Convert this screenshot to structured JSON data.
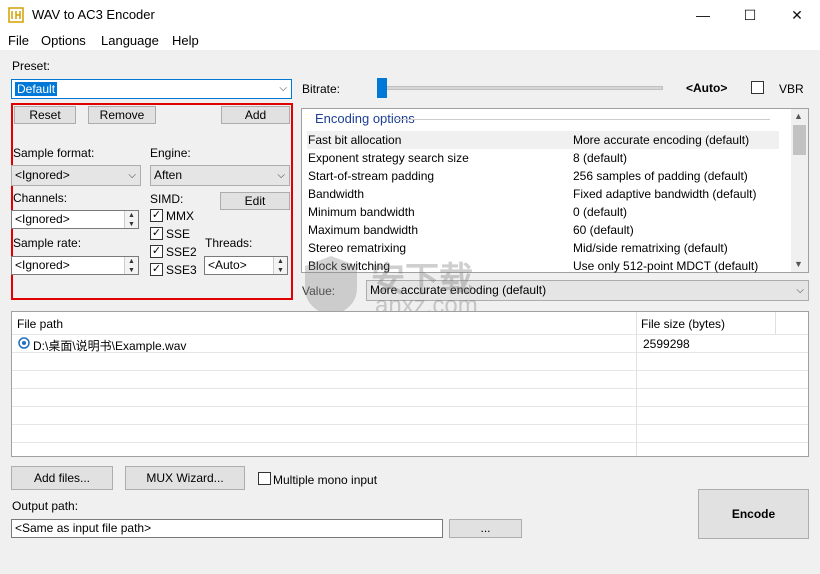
{
  "window": {
    "title": "WAV to AC3 Encoder",
    "minimize_glyph": "—",
    "maximize_glyph": "☐",
    "close_glyph": "✕"
  },
  "menu": [
    "File",
    "Options",
    "Language",
    "Help"
  ],
  "preset": {
    "label": "Preset:",
    "value": "Default",
    "reset": "Reset",
    "remove": "Remove",
    "add": "Add"
  },
  "settings": {
    "sample_format_label": "Sample format:",
    "sample_format_value": "<Ignored>",
    "engine_label": "Engine:",
    "engine_value": "Aften",
    "channels_label": "Channels:",
    "channels_value": "<Ignored>",
    "simd_label": "SIMD:",
    "edit": "Edit",
    "simd": [
      {
        "label": "MMX",
        "checked": true
      },
      {
        "label": "SSE",
        "checked": true
      },
      {
        "label": "SSE2",
        "checked": true
      },
      {
        "label": "SSE3",
        "checked": true
      }
    ],
    "sample_rate_label": "Sample rate:",
    "sample_rate_value": "<Ignored>",
    "threads_label": "Threads:",
    "threads_value": "<Auto>"
  },
  "bitrate": {
    "label": "Bitrate:",
    "value_text": "<Auto>",
    "vbr_label": "VBR",
    "slider_level": 0
  },
  "encoding_options": {
    "title": "Encoding options",
    "rows": [
      {
        "name": "Fast bit allocation",
        "value": "More accurate encoding (default)"
      },
      {
        "name": "Exponent strategy search size",
        "value": "8 (default)"
      },
      {
        "name": "Start-of-stream padding",
        "value": "256 samples of padding (default)"
      },
      {
        "name": "Bandwidth",
        "value": "Fixed adaptive bandwidth (default)"
      },
      {
        "name": "Minimum bandwidth",
        "value": "0 (default)"
      },
      {
        "name": "Maximum bandwidth",
        "value": "60 (default)"
      },
      {
        "name": "Stereo rematrixing",
        "value": "Mid/side rematrixing (default)"
      },
      {
        "name": "Block switching",
        "value": "Use only 512-point MDCT (default)"
      }
    ],
    "value_label": "Value:",
    "value_selected": "More accurate encoding (default)"
  },
  "files": {
    "col_path": "File path",
    "col_size": "File size (bytes)",
    "rows": [
      {
        "path": "D:\\桌面\\说明书\\Example.wav",
        "size": "2599298"
      }
    ]
  },
  "bottom": {
    "add_files": "Add files...",
    "mux_wizard": "MUX Wizard...",
    "multiple_mono": "Multiple mono input",
    "output_label": "Output path:",
    "output_value": "<Same as input file path>",
    "browse": "...",
    "encode": "Encode"
  },
  "watermark": {
    "text_cn": "安下载",
    "text_en": "anxz.com"
  }
}
